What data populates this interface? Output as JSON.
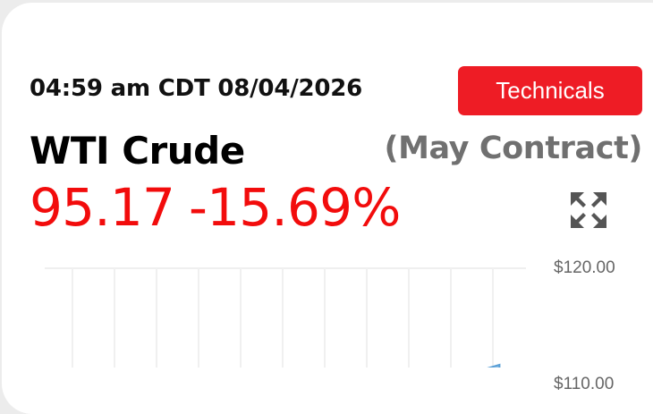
{
  "header": {
    "timestamp": "04:59 am CDT 08/04/2026",
    "technicals_label": "Technicals"
  },
  "instrument": {
    "name": "WTI Crude",
    "contract": "(May Contract)",
    "price": "95.17",
    "change_pct": "-15.69%",
    "change_color": "#f20c0c"
  },
  "icons": {
    "expand": "expand-arrows-icon"
  },
  "colors": {
    "accent": "#ee1c25",
    "series_fill": "#8fbfe6",
    "series_line": "#5a9fd6"
  },
  "chart_data": {
    "type": "area",
    "y_ticks": [
      "$120.00",
      "$110.00"
    ],
    "ylim": [
      110,
      120
    ],
    "series": [
      {
        "x": [
          0.88,
          0.92,
          0.945,
          0.945
        ],
        "values": [
          109,
          111.4,
          111.7,
          109
        ]
      }
    ]
  }
}
